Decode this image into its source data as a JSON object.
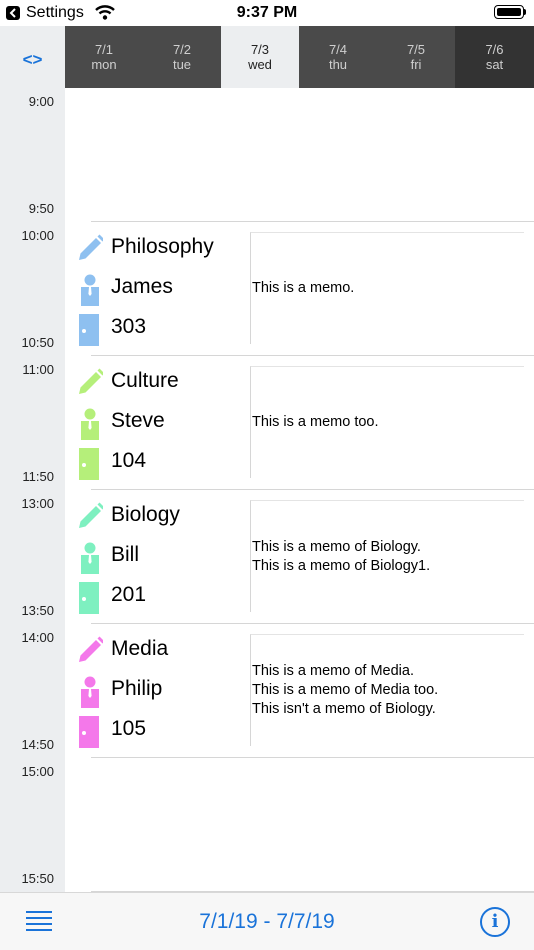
{
  "status_bar": {
    "back_app": "Settings",
    "time": "9:37 PM"
  },
  "nav_arrows_label": "<>",
  "days": [
    {
      "date": "7/1",
      "dow": "mon",
      "bg": "#4a4a4a",
      "fg": "#cfcfcf"
    },
    {
      "date": "7/2",
      "dow": "tue",
      "bg": "#4a4a4a",
      "fg": "#cfcfcf"
    },
    {
      "date": "7/3",
      "dow": "wed",
      "bg": "#eceef0",
      "fg": "#222222"
    },
    {
      "date": "7/4",
      "dow": "thu",
      "bg": "#4a4a4a",
      "fg": "#cfcfcf"
    },
    {
      "date": "7/5",
      "dow": "fri",
      "bg": "#4a4a4a",
      "fg": "#cfcfcf"
    },
    {
      "date": "7/6",
      "dow": "sat",
      "bg": "#333333",
      "fg": "#cfcfcf"
    }
  ],
  "time_labels": [
    "9:00",
    "9:50",
    "10:00",
    "10:50",
    "11:00",
    "11:50",
    "13:00",
    "13:50",
    "14:00",
    "14:50",
    "15:00",
    "15:50"
  ],
  "entries": [
    {
      "subject": "Philosophy",
      "teacher": "James",
      "room": "303",
      "color": "#8ec0f0",
      "memo": [
        "This is a memo."
      ]
    },
    {
      "subject": "Culture",
      "teacher": "Steve",
      "room": "104",
      "color": "#b5ef7a",
      "memo": [
        "This is a memo too."
      ]
    },
    {
      "subject": "Biology",
      "teacher": "Bill",
      "room": "201",
      "color": "#7ef0c0",
      "memo": [
        "This is a memo of Biology.",
        "This is a memo of Biology1."
      ]
    },
    {
      "subject": "Media",
      "teacher": "Philip",
      "room": "105",
      "color": "#f478ea",
      "memo": [
        "This is a memo of Media.",
        "This is a memo of Media too.",
        "This isn't a memo of Biology."
      ]
    }
  ],
  "toolbar": {
    "date_range": "7/1/19 - 7/7/19",
    "info_label": "i"
  },
  "colors": {
    "accent": "#1a73d9"
  }
}
